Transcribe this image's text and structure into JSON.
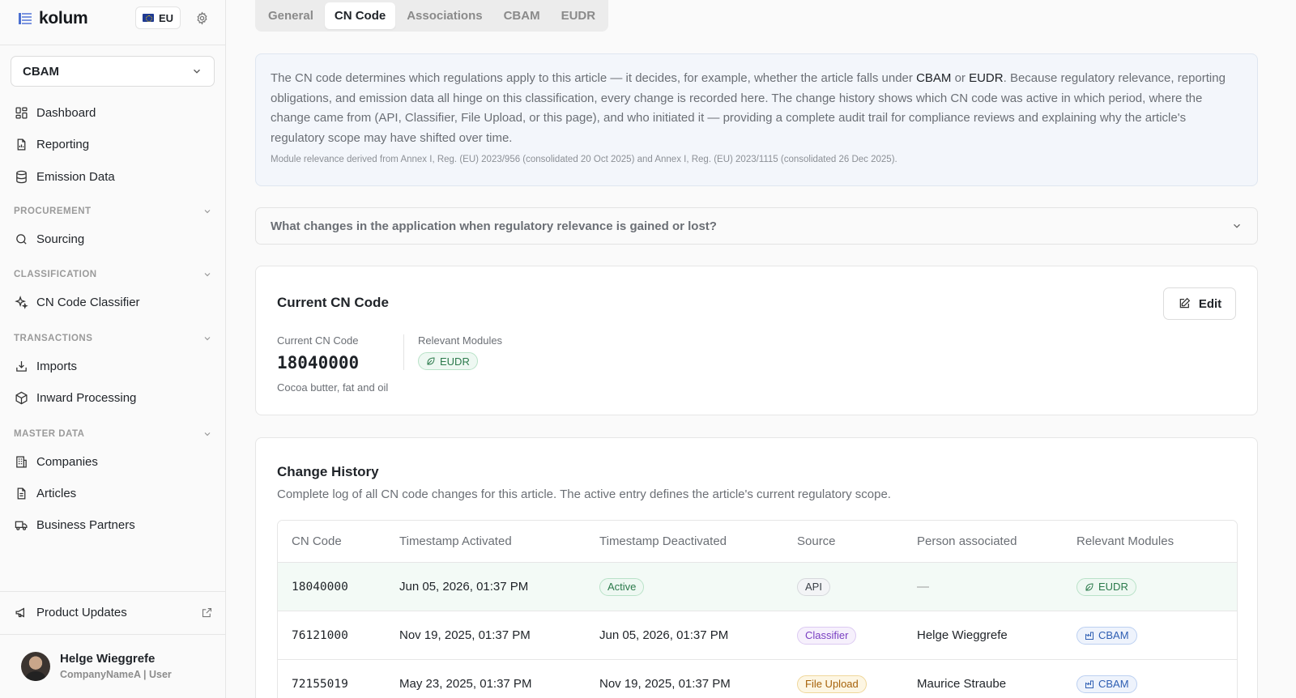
{
  "sidebar": {
    "brand": "kolum",
    "region": "EU",
    "module_select": "CBAM",
    "items_top": [
      {
        "label": "Dashboard",
        "icon": "dashboard-icon"
      },
      {
        "label": "Reporting",
        "icon": "report-file-icon"
      },
      {
        "label": "Emission Data",
        "icon": "database-icon"
      }
    ],
    "sections": {
      "procurement": "PROCUREMENT",
      "classification": "CLASSIFICATION",
      "transactions": "TRANSACTIONS",
      "master_data": "MASTER DATA"
    },
    "sourcing": "Sourcing",
    "cn_classifier": "CN Code Classifier",
    "imports": "Imports",
    "inward_processing": "Inward Processing",
    "companies": "Companies",
    "articles": "Articles",
    "business_partners": "Business Partners",
    "product_updates": "Product Updates",
    "user": {
      "name": "Helge Wieggrefe",
      "org": "CompanyNameA | User"
    }
  },
  "tabs": [
    {
      "label": "General",
      "active": false
    },
    {
      "label": "CN Code",
      "active": true
    },
    {
      "label": "Associations",
      "active": false
    },
    {
      "label": "CBAM",
      "active": false
    },
    {
      "label": "EUDR",
      "active": false
    }
  ],
  "info": {
    "p1": "The CN code determines which regulations apply to this article — it decides, for example, whether the article falls under ",
    "cbam": "CBAM",
    "or": " or ",
    "eudr": "EUDR",
    "p2": ". Because regulatory relevance, reporting obligations, and emission data all hinge on this classification, every change is recorded here. The change history shows which CN code was active in which period, where the change came from (API, Classifier, File Upload, or this page), and who initiated it — providing a complete audit trail for compliance reviews and explaining why the article's regulatory scope may have shifted over time.",
    "small": "Module relevance derived from Annex I, Reg. (EU) 2023/956 (consolidated 20 Oct 2025) and Annex I, Reg. (EU) 2023/1115 (consolidated 26 Dec 2025)."
  },
  "accordion": "What changes in the application when regulatory relevance is gained or lost?",
  "current": {
    "title": "Current CN Code",
    "edit": "Edit",
    "code_label": "Current CN Code",
    "code": "18040000",
    "desc": "Cocoa butter, fat and oil",
    "modules_label": "Relevant Modules",
    "module": "EUDR"
  },
  "history": {
    "title": "Change History",
    "subtitle": "Complete log of all CN code changes for this article. The active entry defines the article's current regulatory scope.",
    "columns": [
      "CN Code",
      "Timestamp Activated",
      "Timestamp Deactivated",
      "Source",
      "Person associated",
      "Relevant Modules"
    ],
    "rows": [
      {
        "code": "18040000",
        "activated": "Jun 05, 2026, 01:37 PM",
        "deactivated": "Active",
        "source": "API",
        "person": "—",
        "module": "EUDR"
      },
      {
        "code": "76121000",
        "activated": "Nov 19, 2025, 01:37 PM",
        "deactivated": "Jun 05, 2026, 01:37 PM",
        "source": "Classifier",
        "person": "Helge Wieggrefe",
        "module": "CBAM"
      },
      {
        "code": "72155019",
        "activated": "May 23, 2025, 01:37 PM",
        "deactivated": "Nov 19, 2025, 01:37 PM",
        "source": "File Upload",
        "person": "Maurice Straube",
        "module": "CBAM"
      }
    ]
  }
}
